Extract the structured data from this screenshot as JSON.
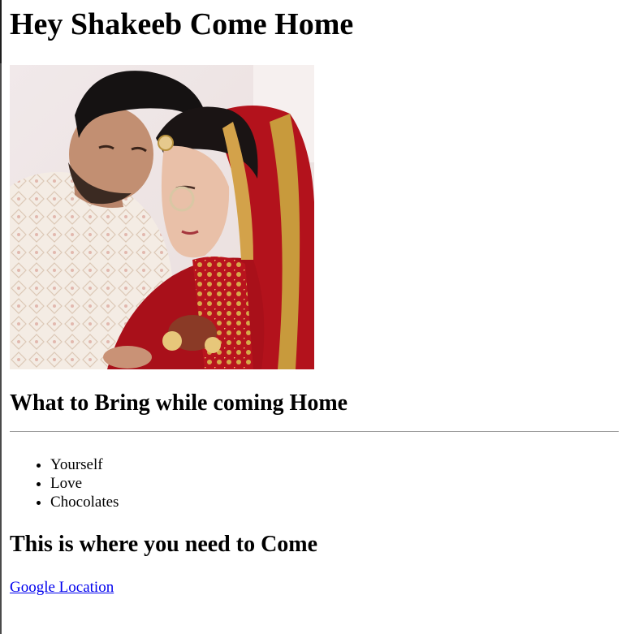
{
  "page": {
    "title": "Hey Shakeeb Come Home",
    "photo_icon": "couple-photo",
    "bring_heading": "What to Bring while coming Home",
    "bring_items": [
      "Yourself",
      "Love",
      "Chocolates"
    ],
    "where_heading": "This is where you need to Come",
    "location_link": "Google Location"
  },
  "colors": {
    "link": "#0000ee",
    "rule": "#9a9a9a",
    "text": "#000000"
  }
}
